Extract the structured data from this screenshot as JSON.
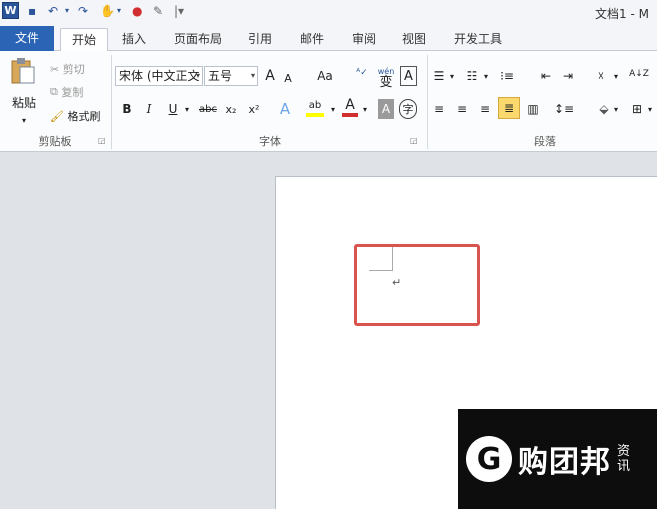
{
  "app": {
    "title": "文档1 - M"
  },
  "tabs": [
    "文件",
    "开始",
    "插入",
    "页面布局",
    "引用",
    "邮件",
    "审阅",
    "视图",
    "开发工具"
  ],
  "clipboard": {
    "paste": "粘贴",
    "cut": "剪切",
    "copy": "复制",
    "format_painter": "格式刷",
    "group": "剪贴板"
  },
  "font": {
    "name": "宋体 (中文正文",
    "size": "五号",
    "group": "字体",
    "aa": "Aa",
    "bold": "B",
    "italic": "I",
    "underline": "U",
    "strike": "abc",
    "sub": "x₂",
    "sup": "x²",
    "grow": "A",
    "shrink": "A",
    "pinyin": "wén",
    "pinyin_char": "变",
    "border_char": "A",
    "font_color": "A",
    "shade": "A",
    "circle": "字",
    "highlight": "ab"
  },
  "paragraph": {
    "group": "段落",
    "sort": "A↓Z"
  },
  "watermark": {
    "brand": "购团邦",
    "sub": "资讯"
  },
  "colors": {
    "file_tab": "#2b63b5",
    "highlight": "#d9534f",
    "font_red": "#d12f2f",
    "highlight_yellow": "#ffff00"
  }
}
